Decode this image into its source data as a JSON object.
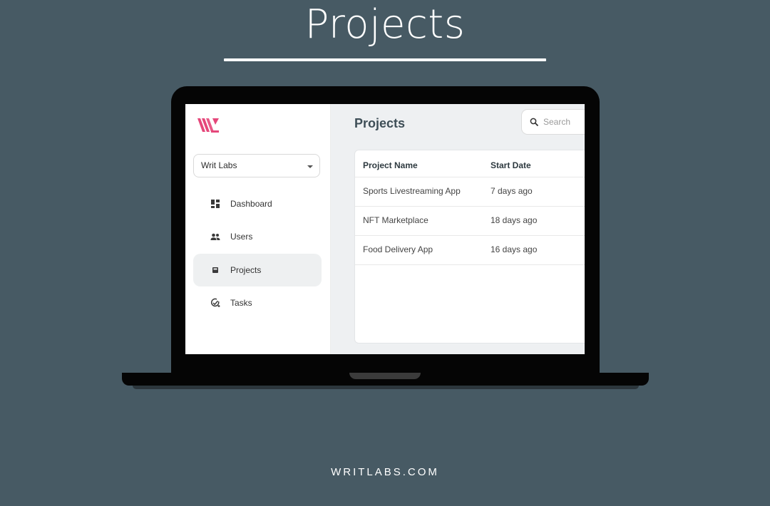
{
  "banner": {
    "title": "Projects"
  },
  "app": {
    "org_select": {
      "value": "Writ Labs"
    },
    "nav": [
      {
        "label": "Dashboard",
        "icon": "dashboard-icon"
      },
      {
        "label": "Users",
        "icon": "users-icon"
      },
      {
        "label": "Projects",
        "icon": "projects-icon",
        "active": true
      },
      {
        "label": "Tasks",
        "icon": "tasks-icon"
      }
    ],
    "page_title": "Projects",
    "search": {
      "placeholder": "Search",
      "value": ""
    },
    "table": {
      "columns": [
        "Project Name",
        "Start Date"
      ],
      "rows": [
        [
          "Sports Livestreaming App",
          "7 days ago"
        ],
        [
          "NFT Marketplace",
          "18 days ago"
        ],
        [
          "Food Delivery App",
          "16 days ago"
        ]
      ]
    }
  },
  "footer": {
    "url": "WRITLABS.COM"
  },
  "colors": {
    "background": "#475a64",
    "logo_pink": "#e5477a",
    "active_nav": "#eef0f1"
  }
}
